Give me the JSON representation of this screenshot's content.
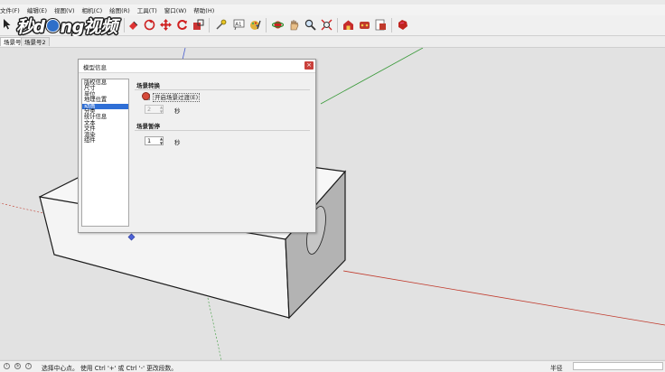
{
  "menu": {
    "items": [
      "文件(F)",
      "编辑(E)",
      "视图(V)",
      "相机(C)",
      "绘图(R)",
      "工具(T)",
      "窗口(W)",
      "帮助(H)"
    ]
  },
  "logo": {
    "text_a": "秒d",
    "text_b": "ng视频"
  },
  "toolbar": {
    "icons": [
      "select-icon",
      "paint-bucket-icon",
      "push-pull-icon",
      "move-icon",
      "rotate-icon",
      "scale-icon",
      "tape-measure-icon",
      "text-icon",
      "paint-icon",
      "orbit-icon",
      "pan-icon",
      "zoom-icon",
      "zoom-extents-icon",
      "warehouse-icon",
      "extension-icon",
      "layout-icon",
      "ruby-icon"
    ]
  },
  "scene_tabs": [
    "场景号1",
    "场景号2"
  ],
  "dialog": {
    "title": "模型信息",
    "close_label": "×",
    "list_items": [
      "版权信息",
      "尺寸",
      "单位",
      "地理位置",
      "动画",
      "分类",
      "统计信息",
      "文本",
      "文件",
      "渲染",
      "组件"
    ],
    "selected_index": 4,
    "section1_title": "场景转换",
    "checkbox_label": "开启场景过渡(E)",
    "transition_value": "2",
    "transition_unit": "秒",
    "section2_title": "场景暂停",
    "delay_value": "1",
    "delay_unit": "秒"
  },
  "status": {
    "message": "选择中心点。 使用 Ctrl '+' 或 Ctrl '-' 更改段数。",
    "measure_label": "半径",
    "measure_value": ""
  },
  "colors": {
    "viewport_bg": "#e2e2e2",
    "selected_item": "#2f6fd6",
    "close_button": "#c9413c",
    "axis_red": "#c0392b",
    "axis_green": "#3a9a3a",
    "axis_blue": "#4a5fcf"
  }
}
